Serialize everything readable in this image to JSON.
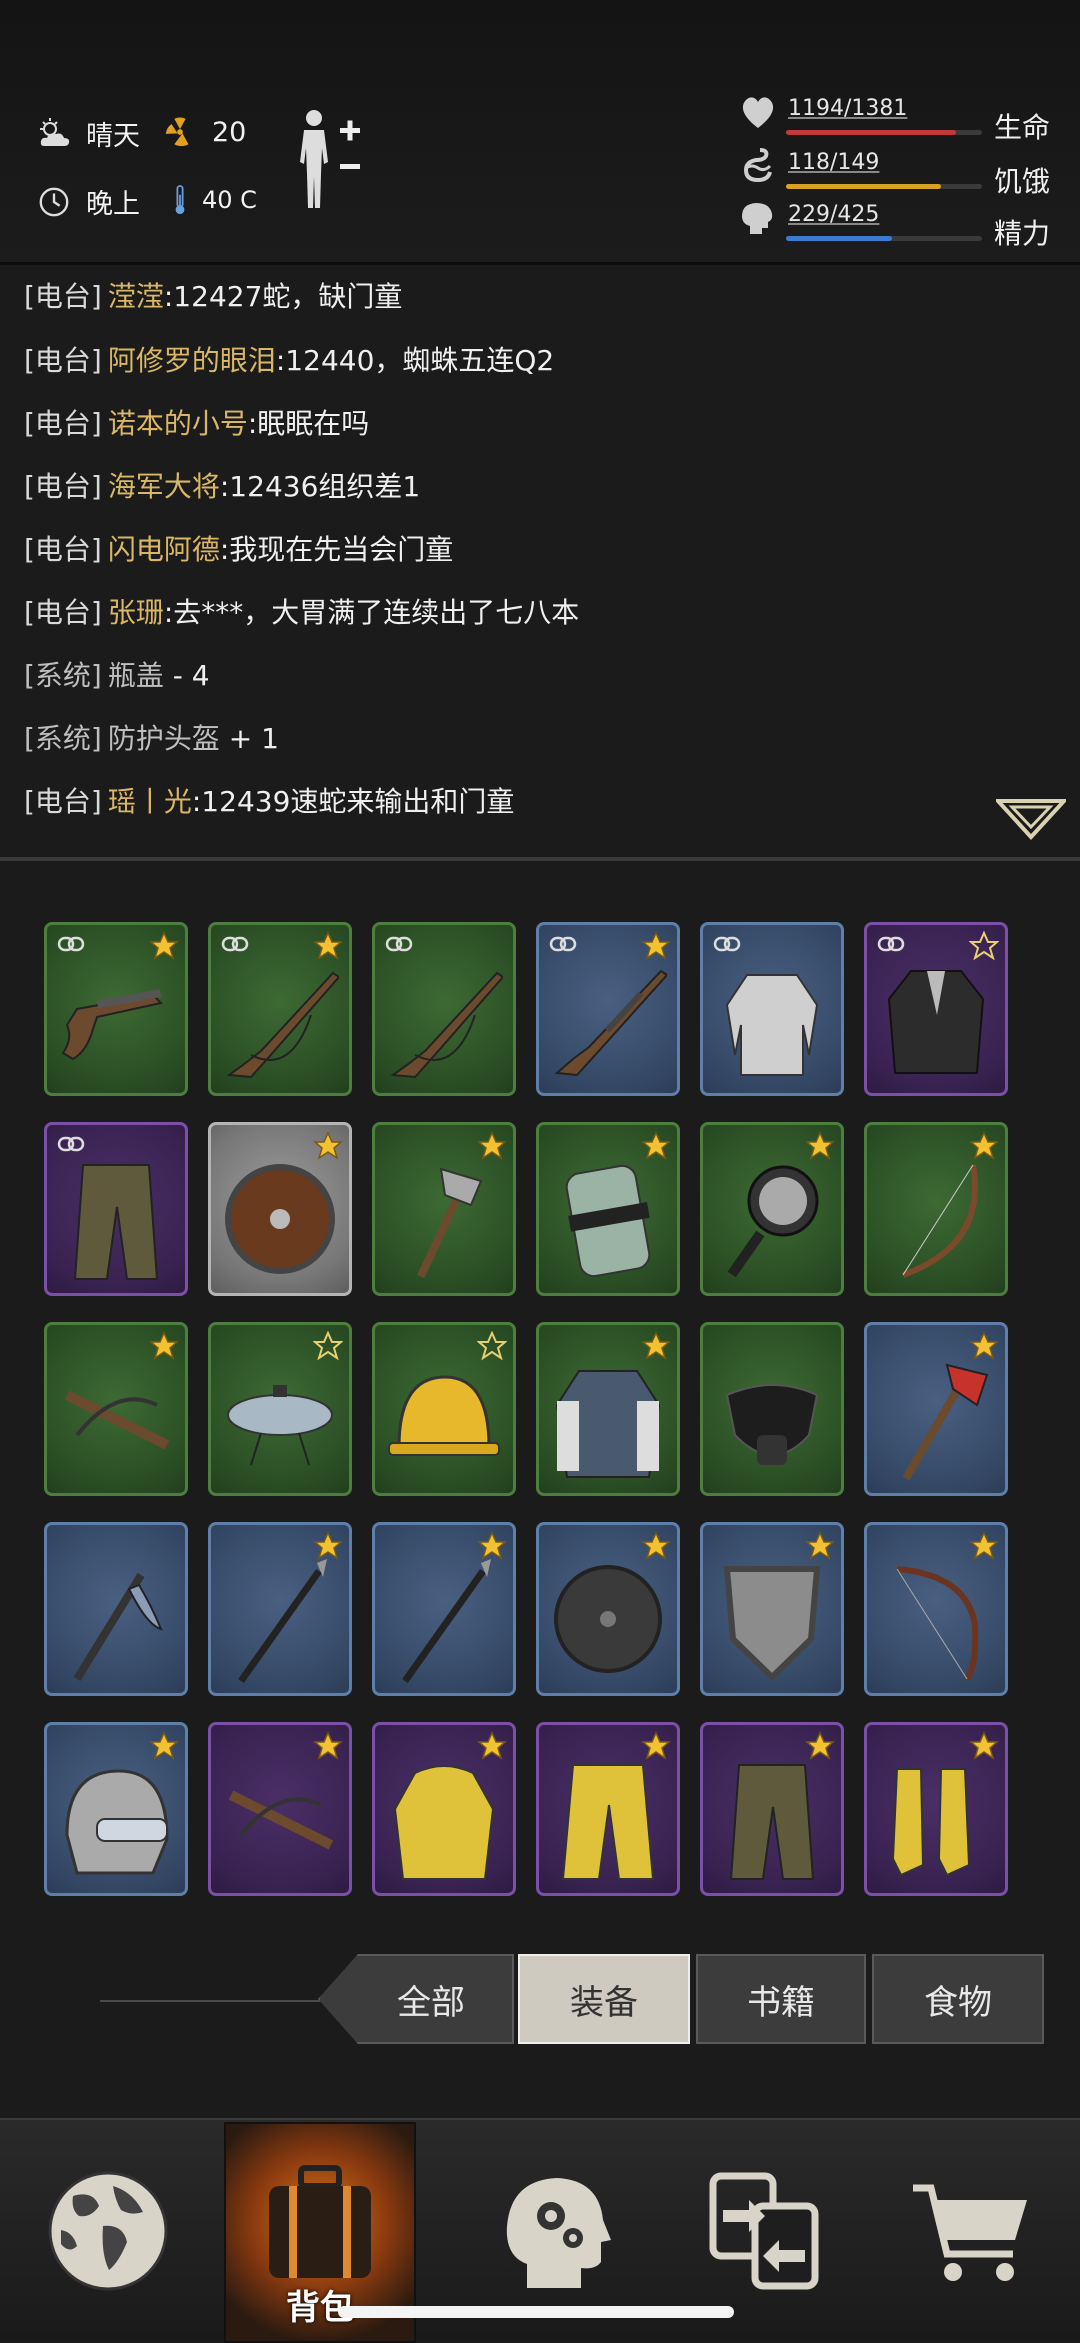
{
  "status": {
    "weather": "晴天",
    "radiation": "20",
    "time_of_day": "晚上",
    "temperature": "40 C"
  },
  "vitals": {
    "life": {
      "label": "生命",
      "text": "1194/1381",
      "fraction": 0.865,
      "color": "#c0393b"
    },
    "hunger": {
      "label": "饥饿",
      "text": "118/149",
      "fraction": 0.79,
      "color": "#d8a324"
    },
    "energy": {
      "label": "精力",
      "text": "229/425",
      "fraction": 0.54,
      "color": "#3d7bd1"
    }
  },
  "chat": [
    {
      "channel": "[电台]",
      "name": "滢滢",
      "message": ":12427蛇，缺门童",
      "type": "radio"
    },
    {
      "channel": "[电台]",
      "name": "阿修罗的眼泪",
      "message": ":12440，蜘蛛五连Q2",
      "type": "radio"
    },
    {
      "channel": "[电台]",
      "name": "诺本的小号",
      "message": ":眠眠在吗",
      "type": "radio"
    },
    {
      "channel": "[电台]",
      "name": "海军大将",
      "message": ":12436组织差1",
      "type": "radio"
    },
    {
      "channel": "[电台]",
      "name": "闪电阿德",
      "message": ":我现在先当会门童",
      "type": "radio"
    },
    {
      "channel": "[电台]",
      "name": "张珊",
      "message": ":去***，大胃满了连续出了七八本",
      "type": "radio"
    },
    {
      "channel": "[系统]",
      "name": "瓶盖",
      "message": " - 4",
      "type": "system"
    },
    {
      "channel": "[系统]",
      "name": "防护头盔",
      "message": " + 1",
      "type": "system"
    },
    {
      "channel": "[电台]",
      "name": "瑶丨光",
      "message": ":12439速蛇来输出和门童",
      "type": "radio"
    }
  ],
  "inventory": [
    {
      "item": "flintlock-pistol",
      "rarity": "green",
      "star": "filled",
      "linked": true
    },
    {
      "item": "hunting-rifle",
      "rarity": "green",
      "star": "filled",
      "linked": true
    },
    {
      "item": "hunting-rifle",
      "rarity": "green",
      "star": "none",
      "linked": true
    },
    {
      "item": "shotgun",
      "rarity": "blue",
      "star": "filled",
      "linked": true
    },
    {
      "item": "shirt",
      "rarity": "blue",
      "star": "none",
      "linked": true
    },
    {
      "item": "jacket",
      "rarity": "purple",
      "star": "outline",
      "linked": true
    },
    {
      "item": "pants",
      "rarity": "purple",
      "star": "none",
      "linked": true
    },
    {
      "item": "wooden-shield",
      "rarity": "grey",
      "star": "filled",
      "linked": false
    },
    {
      "item": "hatchet",
      "rarity": "green",
      "star": "filled",
      "linked": false
    },
    {
      "item": "riot-shield",
      "rarity": "green",
      "star": "filled",
      "linked": false
    },
    {
      "item": "frying-pan",
      "rarity": "green",
      "star": "filled",
      "linked": false
    },
    {
      "item": "bow",
      "rarity": "green",
      "star": "filled",
      "linked": false
    },
    {
      "item": "crossbow",
      "rarity": "green",
      "star": "filled",
      "linked": false
    },
    {
      "item": "pot-lid",
      "rarity": "green",
      "star": "outline",
      "linked": false
    },
    {
      "item": "hard-hat",
      "rarity": "green",
      "star": "outline",
      "linked": false
    },
    {
      "item": "varsity-jacket",
      "rarity": "green",
      "star": "filled",
      "linked": false
    },
    {
      "item": "gas-mask",
      "rarity": "green",
      "star": "none",
      "linked": false
    },
    {
      "item": "fire-axe",
      "rarity": "blue",
      "star": "filled",
      "linked": false
    },
    {
      "item": "pickaxe",
      "rarity": "blue",
      "star": "none",
      "linked": false
    },
    {
      "item": "spear",
      "rarity": "blue",
      "star": "filled",
      "linked": false
    },
    {
      "item": "spear",
      "rarity": "blue",
      "star": "filled",
      "linked": false
    },
    {
      "item": "round-shield",
      "rarity": "blue",
      "star": "filled",
      "linked": false
    },
    {
      "item": "metal-shield",
      "rarity": "blue",
      "star": "filled",
      "linked": false
    },
    {
      "item": "recurve-bow",
      "rarity": "blue",
      "star": "filled",
      "linked": false
    },
    {
      "item": "motorcycle-helmet",
      "rarity": "blue",
      "star": "filled",
      "linked": false
    },
    {
      "item": "crossbow",
      "rarity": "purple",
      "star": "filled",
      "linked": false
    },
    {
      "item": "raincoat",
      "rarity": "purple",
      "star": "filled",
      "linked": false
    },
    {
      "item": "rain-pants",
      "rarity": "purple",
      "star": "filled",
      "linked": false
    },
    {
      "item": "cargo-pants",
      "rarity": "purple",
      "star": "filled",
      "linked": false
    },
    {
      "item": "rain-boots",
      "rarity": "purple",
      "star": "filled",
      "linked": false
    }
  ],
  "filters": {
    "all": "全部",
    "equipment": "装备",
    "books": "书籍",
    "food": "食物",
    "selected": "装备"
  },
  "nav": {
    "items": [
      "world-map",
      "backpack",
      "skills",
      "trade",
      "shop"
    ],
    "active": "backpack",
    "backpack_label": "背包"
  }
}
